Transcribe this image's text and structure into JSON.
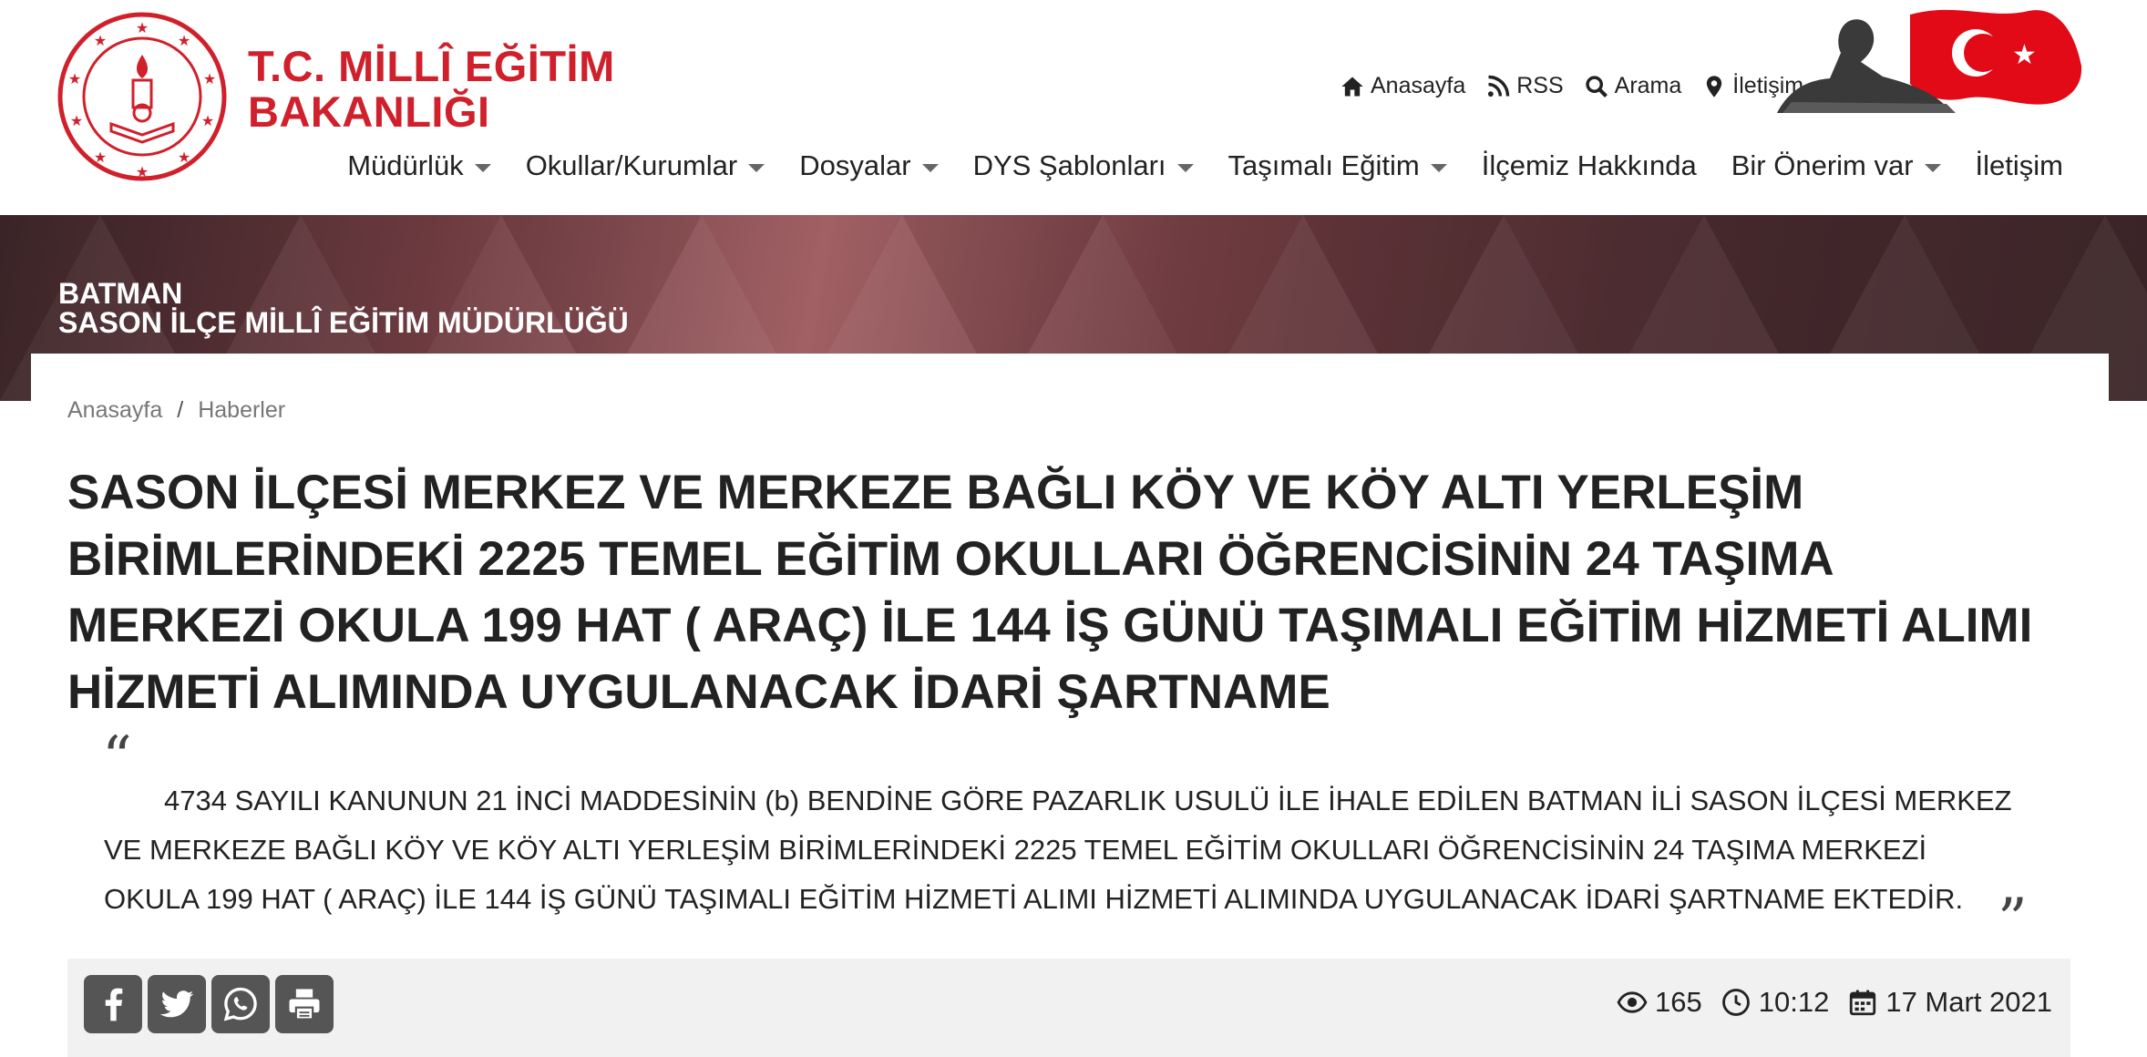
{
  "brand": {
    "line1": "T.C. MİLLÎ EĞİTİM",
    "line2": "BAKANLIĞI",
    "color": "#d0202b"
  },
  "top_links": [
    {
      "label": "Anasayfa",
      "icon": "home-icon"
    },
    {
      "label": "RSS",
      "icon": "rss-icon"
    },
    {
      "label": "Arama",
      "icon": "search-icon"
    },
    {
      "label": "İletişim",
      "icon": "map-marker-icon"
    }
  ],
  "nav": [
    {
      "label": "Müdürlük",
      "dropdown": true
    },
    {
      "label": "Okullar/Kurumlar",
      "dropdown": true
    },
    {
      "label": "Dosyalar",
      "dropdown": true
    },
    {
      "label": "DYS Şablonları",
      "dropdown": true
    },
    {
      "label": "Taşımalı Eğitim",
      "dropdown": true
    },
    {
      "label": "İlçemiz Hakkında",
      "dropdown": false
    },
    {
      "label": "Bir Önerim var",
      "dropdown": true
    },
    {
      "label": "İletişim",
      "dropdown": false
    }
  ],
  "banner": {
    "line1": "BATMAN",
    "line2": "SASON İLÇE MİLLÎ EĞİTİM MÜDÜRLÜĞÜ"
  },
  "breadcrumb": {
    "home": "Anasayfa",
    "separator": "/",
    "current": "Haberler"
  },
  "article": {
    "title": "SASON İLÇESİ MERKEZ VE MERKEZE BAĞLI KÖY VE KÖY ALTI YERLEŞİM BİRİMLERİNDEKİ 2225 TEMEL EĞİTİM OKULLARI ÖĞRENCİSİNİN 24 TAŞIMA MERKEZİ OKULA 199 HAT ( ARAÇ) İLE 144 İŞ GÜNÜ TAŞIMALI EĞİTİM HİZMETİ ALIMI HİZMETİ ALIMINDA UYGULANACAK İDARİ ŞARTNAME",
    "quote_open": "“",
    "quote_close": "”",
    "summary": "4734 SAYILI KANUNUN 21 İNCİ MADDESİNİN (b) BENDİNE GÖRE PAZARLIK USULÜ İLE İHALE EDİLEN BATMAN İLİ SASON İLÇESİ MERKEZ VE MERKEZE BAĞLI KÖY VE KÖY ALTI YERLEŞİM BİRİMLERİNDEKİ 2225 TEMEL EĞİTİM OKULLARI ÖĞRENCİSİNİN 24 TAŞIMA MERKEZİ OKULA 199 HAT ( ARAÇ) İLE 144 İŞ GÜNÜ TAŞIMALI EĞİTİM HİZMETİ ALIMI HİZMETİ ALIMINDA UYGULANACAK İDARİ ŞARTNAME EKTEDİR."
  },
  "share": [
    {
      "icon": "facebook-icon"
    },
    {
      "icon": "twitter-icon"
    },
    {
      "icon": "whatsapp-icon"
    },
    {
      "icon": "print-icon"
    }
  ],
  "meta": {
    "views": "165",
    "time": "10:12",
    "date": "17 Mart 2021"
  }
}
